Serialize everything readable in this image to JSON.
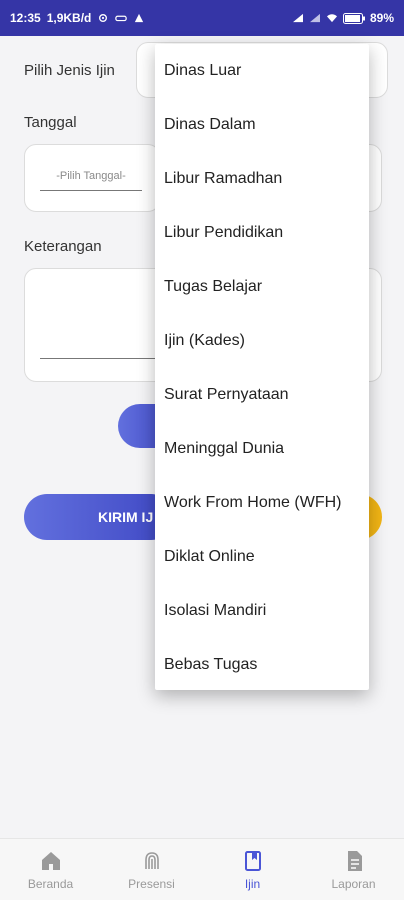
{
  "status_bar": {
    "time": "12:35",
    "network_speed": "1,9KB/d",
    "battery": "89"
  },
  "form": {
    "jenis_ijin_label": "Pilih Jenis Ijin",
    "tanggal_label": "Tanggal",
    "tanggal_placeholder": "-Pilih Tanggal-",
    "keterangan_label": "Keterangan",
    "kirim_label": "KIRIM IJ"
  },
  "dropdown": {
    "options": [
      "Dinas Luar",
      "Dinas Dalam",
      "Libur Ramadhan",
      "Libur Pendidikan",
      "Tugas Belajar",
      "Ijin (Kades)",
      "Surat Pernyataan",
      "Meninggal Dunia",
      "Work From Home (WFH)",
      "Diklat Online",
      "Isolasi Mandiri",
      "Bebas Tugas"
    ]
  },
  "bottom_nav": {
    "items": [
      {
        "label": "Beranda",
        "icon": "home-icon"
      },
      {
        "label": "Presensi",
        "icon": "fingerprint-icon"
      },
      {
        "label": "Ijin",
        "icon": "bookmark-icon"
      },
      {
        "label": "Laporan",
        "icon": "document-icon"
      }
    ],
    "active_index": 2
  },
  "colors": {
    "status_bar": "#3535a6",
    "primary": "#4a55d6",
    "accent": "#f2b515"
  }
}
